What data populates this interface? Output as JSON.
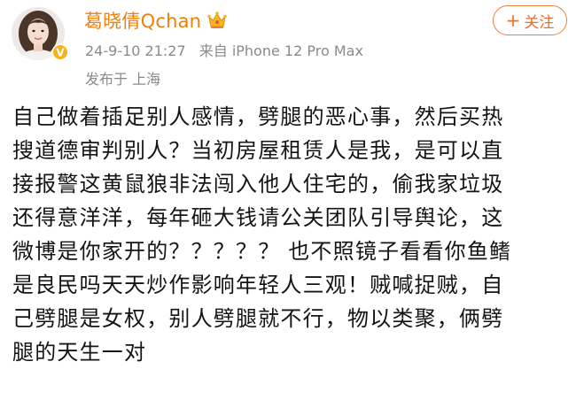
{
  "user": {
    "name": "葛晓倩Qchan",
    "avatar_icon": "avatar-photo",
    "verified_icon": "verified-badge-icon",
    "vip_icon": "crown-icon"
  },
  "meta": {
    "date": "24-9-10 21:27",
    "source": "来自 iPhone 12 Pro Max",
    "location": "发布于 上海"
  },
  "follow": {
    "plus": "+",
    "label": "关注"
  },
  "content_lines": [
    "自己做着插足别人感情，劈腿的恶心事，然后买热",
    "搜道德审判别人？当初房屋租赁人是我，是可以直",
    "接报警这黄鼠狼非法闯入他人住宅的，偷我家垃圾",
    "还得意洋洋，每年砸大钱请公关团队引导舆论，这",
    "微博是你家开的？？？？？ 也不照镜子看看你鱼鳍",
    "是良民吗天天炒作影响年轻人三观！贼喊捉贼，自",
    "己劈腿是女权，别人劈腿就不行，物以类聚，俩劈",
    "腿的天生一对"
  ],
  "colors": {
    "username": "#f0800a",
    "follow": "#ee6d1e",
    "meta": "#8a8a8a",
    "text": "#141414"
  }
}
